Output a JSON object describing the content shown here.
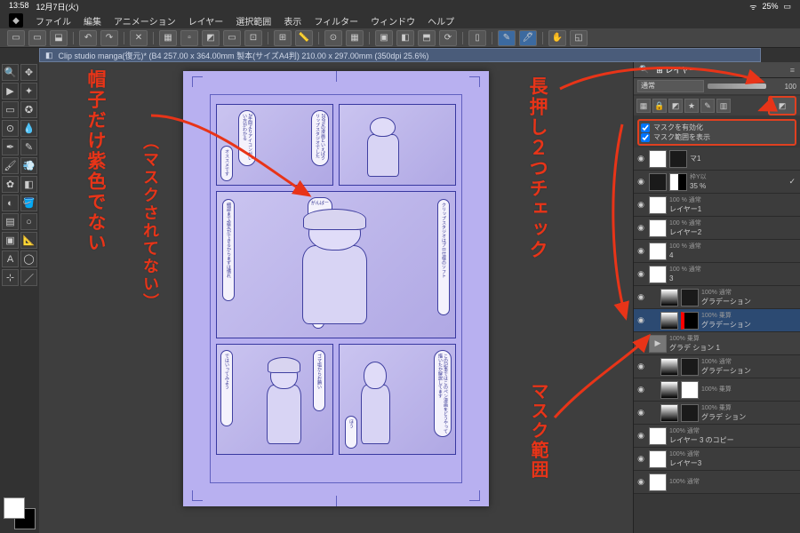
{
  "status": {
    "time": "13:58",
    "date": "12月7日(火)",
    "battery": "25%"
  },
  "menu": [
    "ファイル",
    "編集",
    "アニメーション",
    "レイヤー",
    "選択範囲",
    "表示",
    "フィルター",
    "ウィンドウ",
    "ヘルプ"
  ],
  "document_title": "Clip studio manga(復元)* (B4 257.00 x 364.00mm 製本(サイズA4判) 210.00 x 297.00mm (350dpi 25.6%)",
  "sidebar": {
    "panel_icon": "◧"
  },
  "layer_panel": {
    "tabs": [
      "🔍",
      "⊞ レイヤー",
      "≡"
    ],
    "blend_mode": "通常",
    "opacity": "100",
    "mask_enable": "マスクを有効化",
    "mask_show": "マスク範囲を表示"
  },
  "layers": [
    {
      "vis": "◉",
      "thumb": "white",
      "thumb2": "dark",
      "name": "マ1",
      "meta": ""
    },
    {
      "vis": "◉",
      "thumb": "dark",
      "thumb2": "split",
      "name": "35 %",
      "meta": "枠Y以",
      "chk": true
    },
    {
      "vis": "◉",
      "thumb": "white",
      "name": "レイヤー1",
      "meta": "100 % 通常"
    },
    {
      "vis": "◉",
      "thumb": "white",
      "name": "レイヤー2",
      "meta": "100 % 通常"
    },
    {
      "vis": "◉",
      "thumb": "white",
      "name": "4",
      "meta": "100 % 通常"
    },
    {
      "vis": "◉",
      "thumb": "white",
      "name": "3",
      "meta": "100 % 通常"
    },
    {
      "vis": "◉",
      "thumb": "grad",
      "thumb2": "dark",
      "name": "グラデーション",
      "meta": "100% 通常",
      "indent": 1
    },
    {
      "vis": "◉",
      "thumb": "grad",
      "thumb2": "mask",
      "name": "グラデーション",
      "meta": "100% 乗算",
      "indent": 1,
      "selected": true
    },
    {
      "vis": "◉",
      "thumb": "folder",
      "name": "グラデ ション 1",
      "meta": "100% 乗算",
      "folder": true
    },
    {
      "vis": "◉",
      "thumb": "grad",
      "thumb2": "dark",
      "name": "グラデーション",
      "meta": "100% 通常",
      "indent": 1
    },
    {
      "vis": "◉",
      "thumb": "grad",
      "thumb2": "white",
      "name": "",
      "meta": "100% 乗算",
      "indent": 1
    },
    {
      "vis": "◉",
      "thumb": "grad",
      "thumb2": "dark",
      "name": "グラデ ション",
      "meta": "100% 乗算",
      "indent": 1
    },
    {
      "vis": "◉",
      "thumb": "white",
      "name": "レイヤー 3 のコピー",
      "meta": "100% 通常"
    },
    {
      "vis": "◉",
      "thumb": "white",
      "name": "レイヤー3",
      "meta": "100% 通常"
    },
    {
      "vis": "◉",
      "thumb": "white",
      "name": "",
      "meta": "100% 通常"
    }
  ],
  "annotations": {
    "left1": "帽子だけ紫色でない",
    "left2": "（マスクされてない）",
    "right1": "長押し２つチェック",
    "right2": "マスク範囲"
  },
  "bubbles": {
    "b1": "200%の漫画といえばクリップスタジオでした",
    "b2": "2手間よりアイコンがいい方がわかる",
    "b3": "オススメです",
    "b4": "細部まで設定ができるからまずは慣れ",
    "b5": "がんばー",
    "b6": "クリップスタジオはプロ仕様のソフト",
    "b7": "最初からヘコたれるな",
    "b8": "この記事ではこのペン漫画をどうやって描いたか解説してます",
    "b9": "ではいってみよう",
    "b10": "ほう",
    "b11": "ゴマ塩からお願い"
  }
}
